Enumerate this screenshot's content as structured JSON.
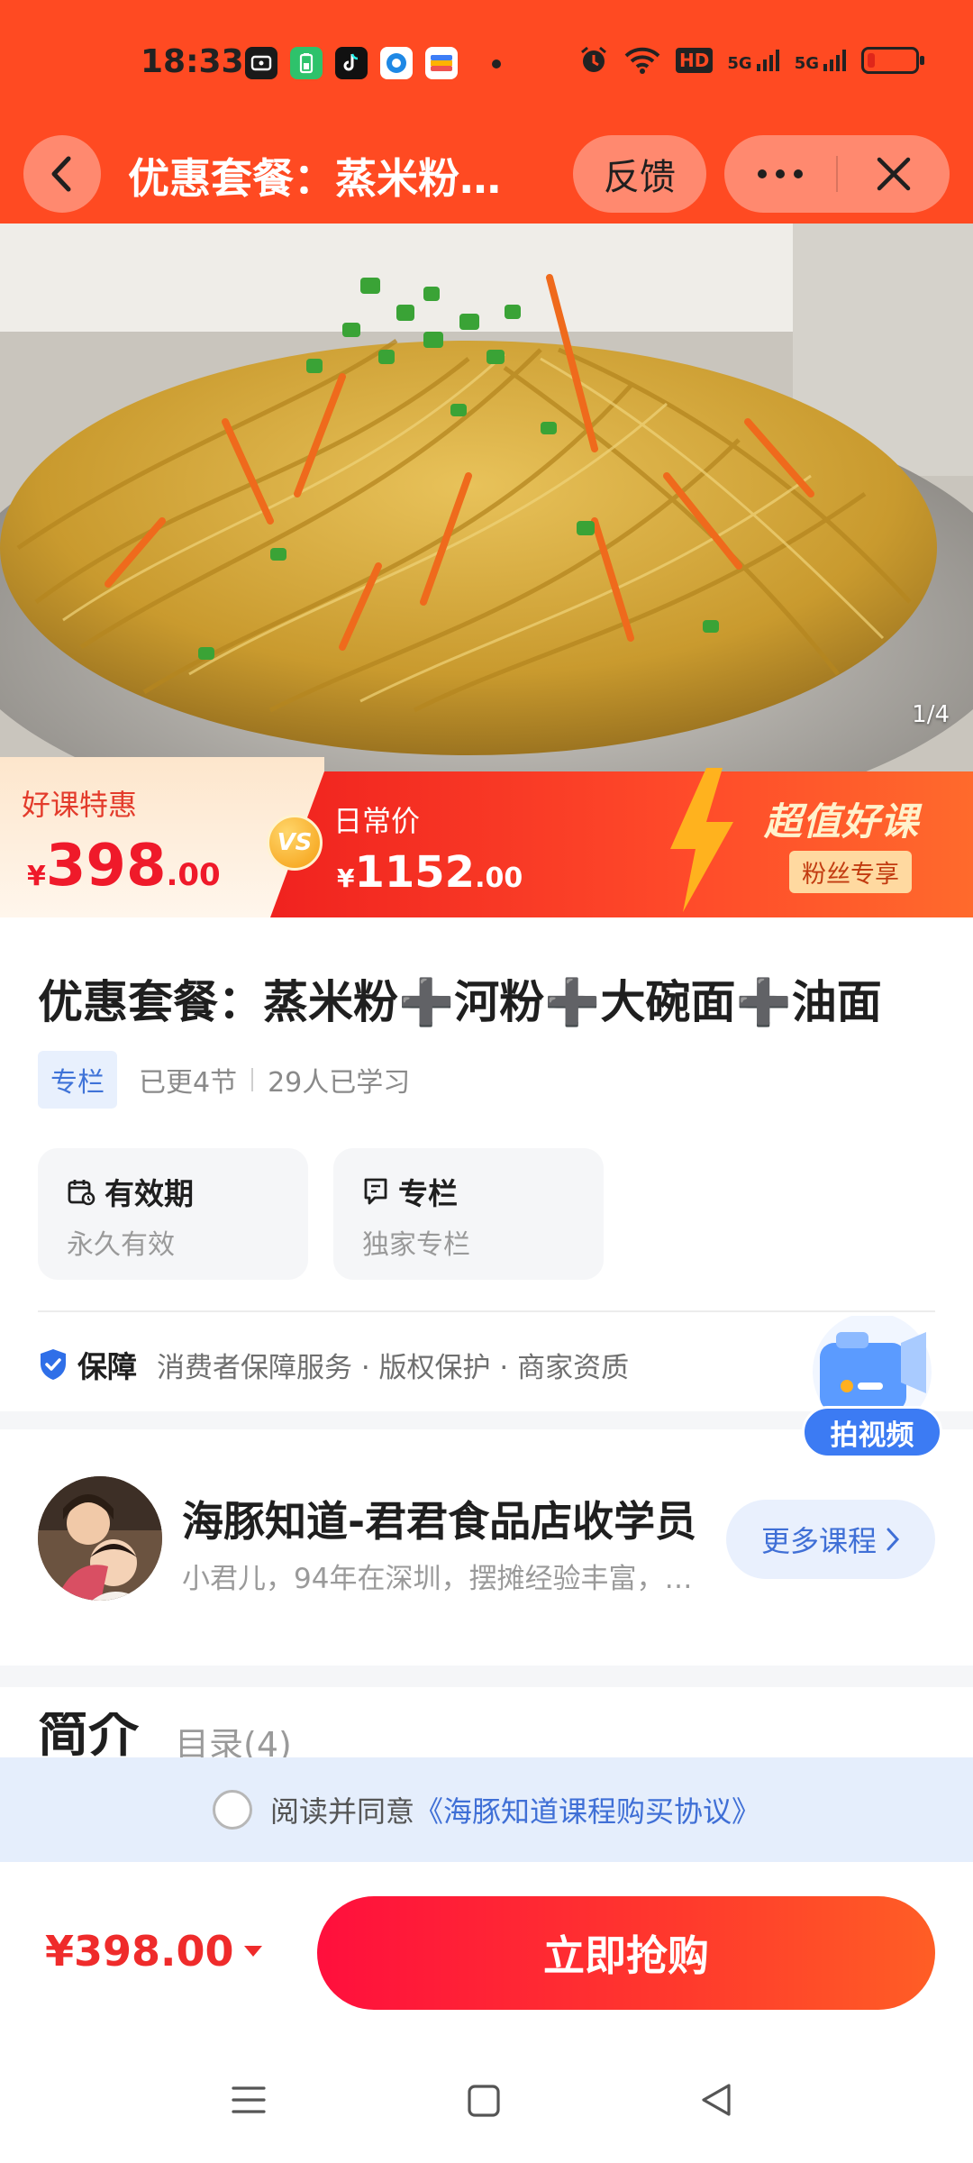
{
  "status_bar": {
    "time": "18:33",
    "icons": [
      "screen-record-icon",
      "battery-saver-icon",
      "tiktok-icon",
      "browser-icon",
      "wallet-icon",
      "alarm-icon",
      "wifi-icon",
      "hd-icon",
      "signal-5g-icon",
      "signal-5g-icon",
      "battery-low-icon"
    ],
    "hd_text": "HD",
    "net_1": "5G",
    "net_2": "5G",
    "colors": {
      "bar": "#ff4a22",
      "battery_low": "#e0261a"
    }
  },
  "nav": {
    "title": "优惠套餐：蒸米粉➕河粉➕大碗面➕油面",
    "feedback_label": "反馈",
    "more_icon": "more-dots-icon",
    "close_icon": "close-icon",
    "back_icon": "back-arrow-icon"
  },
  "hero": {
    "counter": "1/4",
    "image_subject": "stir-fried noodles in steamer"
  },
  "price_banner": {
    "promo_label": "好课特惠",
    "promo_yen": "¥",
    "promo_int": "398",
    "promo_dec": ".00",
    "vs": "VS",
    "regular_label": "日常价",
    "regular_yen": "¥",
    "regular_int": "1152",
    "regular_dec": ".00",
    "badge": "超值好课",
    "badge_tag": "粉丝专享",
    "colors": {
      "accent_red": "#ef1a2a",
      "banner_red": "#f0221f",
      "badge_gold": "#fff2cc"
    }
  },
  "course": {
    "title": "优惠套餐：蒸米粉➕河粉➕大碗面➕油面",
    "type_tag": "专栏",
    "updates": "已更4节",
    "learners": "29人已学习",
    "cards": [
      {
        "icon": "calendar-icon",
        "label": "有效期",
        "value": "永久有效"
      },
      {
        "icon": "bookmark-icon",
        "label": "专栏",
        "value": "独家专栏"
      }
    ]
  },
  "guarantee": {
    "label": "保障",
    "items": "消费者保障服务 · 版权保护 · 商家资质",
    "icon": "shield-check-icon"
  },
  "float_button": {
    "label": "拍视频",
    "icon": "camera-folder-icon"
  },
  "teacher": {
    "name": "海豚知道-君君食品店收学员",
    "desc": "小君儿，94年在深圳，摆摊经验丰富，…",
    "more_label": "更多课程",
    "chevron_icon": "chevron-right-icon"
  },
  "tabs": {
    "active": "简介",
    "second": "目录(4)"
  },
  "agreement": {
    "prefix": "阅读并同意",
    "link": "《海豚知道课程购买协议》"
  },
  "bottom_bar": {
    "price": "¥398.00",
    "buy_label": "立即抢购",
    "colors": {
      "price_red": "#ef2b2b",
      "button_start": "#ff0f3d",
      "button_end": "#ff5e25"
    }
  },
  "system_nav": {
    "menu_icon": "menu-lines-icon",
    "home_icon": "home-square-icon",
    "back_icon": "back-triangle-icon"
  }
}
